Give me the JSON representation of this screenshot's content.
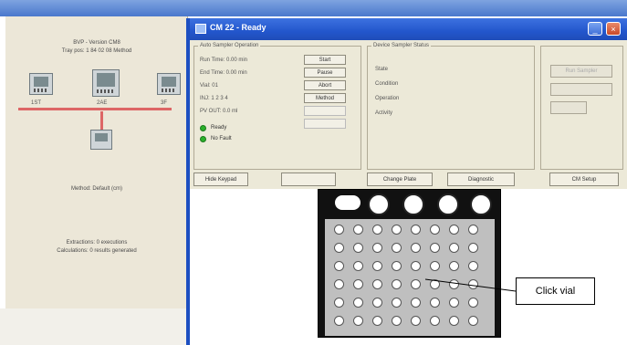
{
  "background_window": {
    "status_line_1": "BVP - Version CM8",
    "status_line_2": "Tray pos: 1 84 02 08 Method",
    "module_labels": [
      "1ST",
      "2AE",
      "3F"
    ],
    "method_label": "Method: Default (cm)",
    "extraction_line_1": "Extractions: 0 executions",
    "extraction_line_2": "Calculations: 0 results generated"
  },
  "cm_window": {
    "title": "CM 22 - Ready",
    "title_buttons": [
      "_",
      "×"
    ],
    "auto_sampler_group": {
      "label": "Auto Sampler Operation",
      "rows": [
        {
          "label": "Run Time: 0.00 min",
          "button": "Start"
        },
        {
          "label": "End Time: 0.00 min",
          "button": "Pause"
        },
        {
          "label": "Vial:    01",
          "button": "Abort"
        },
        {
          "label": "INJ:   1  2  3  4",
          "button": "Method"
        },
        {
          "label": "PV OUT:   0.0 ml",
          "button": ""
        }
      ],
      "status": [
        "Ready",
        "No Fault"
      ]
    },
    "device_group": {
      "label": "Device Sampler Status",
      "items": [
        "State",
        "Condition",
        "Operation",
        "Activity"
      ]
    },
    "right_group": {
      "button_1": "Run Sampler"
    },
    "bottom_buttons": [
      "Hide Keypad",
      "",
      "Change Plate",
      "Diagnostic",
      "CM Setup"
    ]
  },
  "tray": {
    "caps": [
      "",
      "",
      "",
      "",
      ""
    ],
    "rows": 6,
    "cols": 8
  },
  "callout": {
    "text": "Click vial"
  },
  "colors": {
    "titlebar": "#2356cc",
    "accent_led": "#2bb02b",
    "wire": "#d66666"
  }
}
